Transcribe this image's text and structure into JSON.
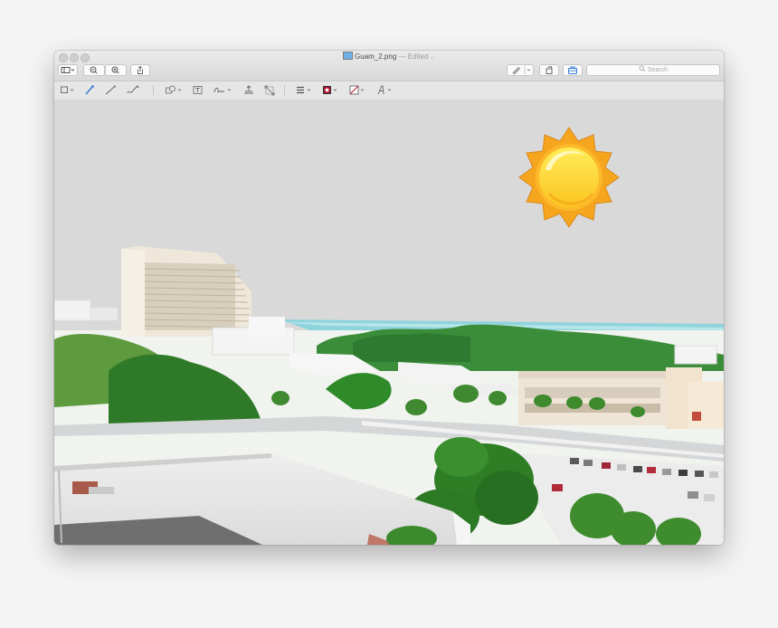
{
  "window": {
    "title": "Guam_2.png",
    "edited_label": "— Edited",
    "title_chevron": "⌵"
  },
  "toolbar": {
    "sidebar_icon": "sidebar-icon",
    "zoom_out_icon": "zoom-out-icon",
    "zoom_in_icon": "zoom-in-icon",
    "share_icon": "share-icon",
    "pen_icon": "pen-icon",
    "rotate_icon": "rotate-icon",
    "toolbox_icon": "toolbox-icon",
    "search_placeholder": "Search"
  },
  "markup": {
    "tools": [
      "rectangular-selection",
      "instant-alpha",
      "sketch",
      "draw",
      "shapes",
      "text",
      "sign",
      "adjust-color",
      "adjust-size",
      "shape-style",
      "border-color",
      "fill-color",
      "text-style"
    ],
    "border_color": "#c8102e",
    "fill_color": "#ffffff"
  },
  "canvas": {
    "background": "#d9d9d9",
    "sun_outer": "#f6a61e",
    "sun_inner": "#fde03a",
    "sea": "#8fd3dc",
    "sky_gray": "#d9d9d9"
  }
}
